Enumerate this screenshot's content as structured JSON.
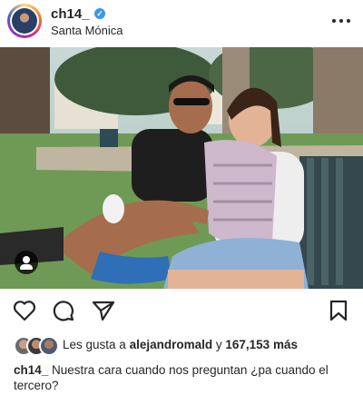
{
  "post": {
    "username": "ch14_",
    "location": "Santa Mónica",
    "likes": {
      "prefix": "Les gusta a",
      "user": "alejandromald",
      "connector": "y",
      "count": "167,153 más"
    },
    "caption": {
      "username": "ch14_",
      "text": "Nuestra cara cuando nos preguntan ¿pa cuando el tercero?"
    }
  },
  "colors": {
    "verified": "#3897f0",
    "text": "#262626"
  },
  "icons": {
    "more": "more-horizontal-icon",
    "like": "heart-icon",
    "comment": "comment-icon",
    "share": "send-icon",
    "save": "bookmark-icon",
    "tag": "user-tag-icon",
    "verified": "verified-badge-icon"
  }
}
